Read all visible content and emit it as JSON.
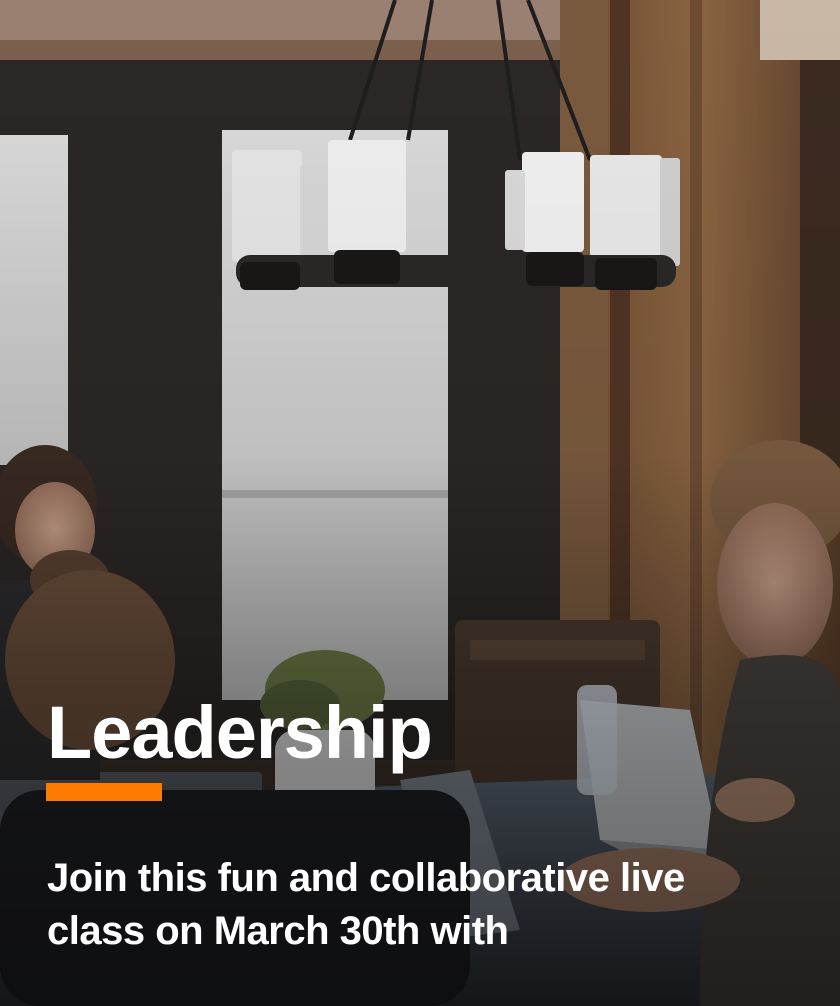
{
  "card": {
    "title": "Leadership",
    "description": "Join this fun and collaborative live class on March 30th with",
    "accent_color": "#ff7a00",
    "background_image": "people working on laptops at a wooden table under a candle chandelier"
  }
}
